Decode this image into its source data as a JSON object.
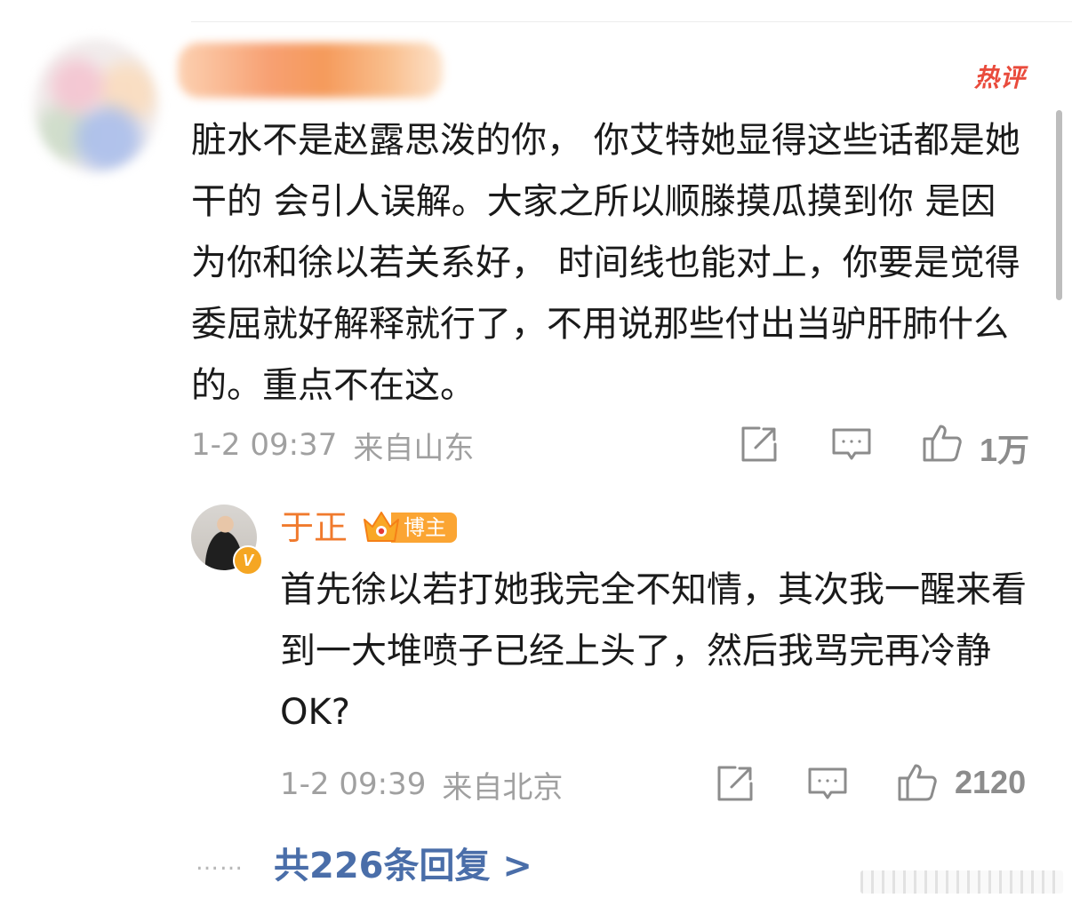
{
  "comment": {
    "hot_badge": "热评",
    "text": "脏水不是赵露思泼的你， 你艾特她显得这些话都是她干的 会引人误解。大家之所以顺滕摸瓜摸到你 是因为你和徐以若关系好， 时间线也能对上，你要是觉得委屈就好解释就行了，不用说那些付出当驴肝肺什么的。重点不在这。",
    "date": "1-2 09:37",
    "location": "来自山东",
    "like_count": "1万",
    "icons": {
      "repost": "edit-share-icon",
      "comment": "comment-bubble-icon",
      "like": "thumbs-up-icon"
    }
  },
  "reply": {
    "username": "于正",
    "author_tag": "博主",
    "verified_mark": "V",
    "text": "首先徐以若打她我完全不知情，其次我一醒来看到一大堆喷子已经上头了，然后我骂完再冷静OK?",
    "date": "1-2 09:39",
    "location": "来自北京",
    "like_count": "2120"
  },
  "more_replies": {
    "dots": "……",
    "label": "共226条回复 >"
  },
  "colors": {
    "hot": "#e94b3c",
    "username": "#f07a2d",
    "author_tag": "#fba533",
    "link": "#4a6ea9",
    "meta": "#a0a0a0"
  }
}
